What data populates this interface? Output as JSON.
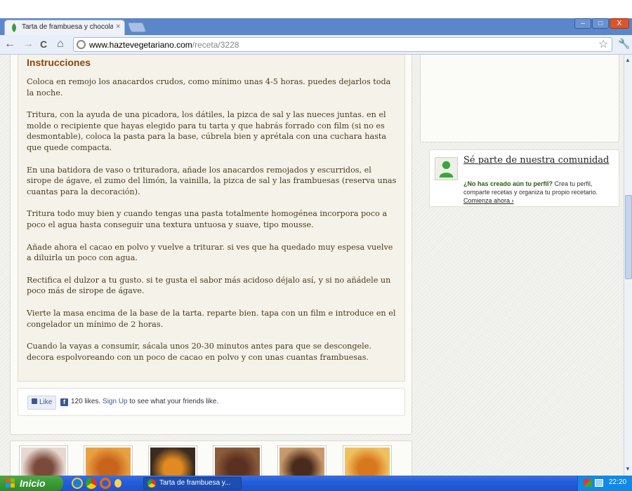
{
  "browser": {
    "tab_title": "Tarta de frambuesa y chocolat",
    "tab_close": "×",
    "url_host": "www.haztevegetariano.com",
    "url_path": "/receta/3228",
    "window_controls": {
      "minimize": "–",
      "maximize": "□",
      "close": "X"
    },
    "nav_icons": {
      "back": "←",
      "forward": "→",
      "reload": "C",
      "home": "⌂",
      "star": "☆",
      "wrench": "🔧"
    }
  },
  "recipe": {
    "heading": "Instrucciones",
    "steps": [
      "Coloca en remojo los anacardos crudos, como mínimo unas 4-5 horas. puedes dejarlos toda la noche.",
      "Tritura, con la ayuda de una picadora, los dátiles, la pizca de sal y las nueces juntas. en el molde o recipiente que hayas elegido para tu tarta y que habrás forrado con film (si no es desmontable), coloca la pasta para la base, cúbrela bien y aprétala con una cuchara hasta que quede compacta.",
      "En una batidora de vaso o trituradora, añade los anacardos remojados y escurridos, el sirope de ágave, el zumo del limón, la vainilla, la pizca de sal y las frambuesas (reserva unas cuantas para la decoración).",
      "Tritura todo muy bien y cuando tengas una pasta totalmente homogénea incorpora poco a poco el agua hasta conseguir una textura untuosa y suave, tipo mousse.",
      "Añade ahora el cacao en polvo y vuelve a triturar. si ves que ha quedado muy espesa vuelve a diluirla un poco con agua.",
      "Rectifica el dulzor a tu gusto. si te gusta el sabor más acidoso déjalo así, y si no añádele un poco más de sirope de ágave.",
      "Vierte la masa encima de la base de la tarta. reparte bien. tapa con un film e introduce en el congelador un mínimo de 2 horas.",
      "Cuando la vayas a consumir, sácala unos 20-30 minutos antes para que se descongele. decora espolvoreando con un poco de cacao en polvo y con unas cuantas frambuesas."
    ]
  },
  "facebook": {
    "like_label": "Like",
    "fb_glyph": "f",
    "count_text": "120 likes.",
    "signup_label": "Sign Up",
    "rest_text": " to see what your friends like."
  },
  "community": {
    "title": "Sé parte de nuestra comunidad",
    "question": "¿No has creado aún tu perfil?",
    "text": " Crea tu perfil, comparte recetas y organiza tu propio recetario.",
    "link": "Comienza ahora ›"
  },
  "related_thumbs": [
    {
      "name": "cupcakes",
      "colors": [
        "#7a4a3a",
        "#e9d8d0"
      ]
    },
    {
      "name": "orange-tart",
      "colors": [
        "#c8641c",
        "#e8a040"
      ]
    },
    {
      "name": "orange-dessert",
      "colors": [
        "#e08a20",
        "#3a2a20"
      ]
    },
    {
      "name": "brownie",
      "colors": [
        "#5a3020",
        "#8a5a3a"
      ]
    },
    {
      "name": "pastry",
      "colors": [
        "#4a2a1a",
        "#c89a6a"
      ]
    },
    {
      "name": "fruit-ring",
      "colors": [
        "#d8781c",
        "#f0c060"
      ]
    }
  ],
  "taskbar": {
    "start_label": "Inicio",
    "task_label": "Tarta de frambuesa y...",
    "clock": "22:20"
  }
}
